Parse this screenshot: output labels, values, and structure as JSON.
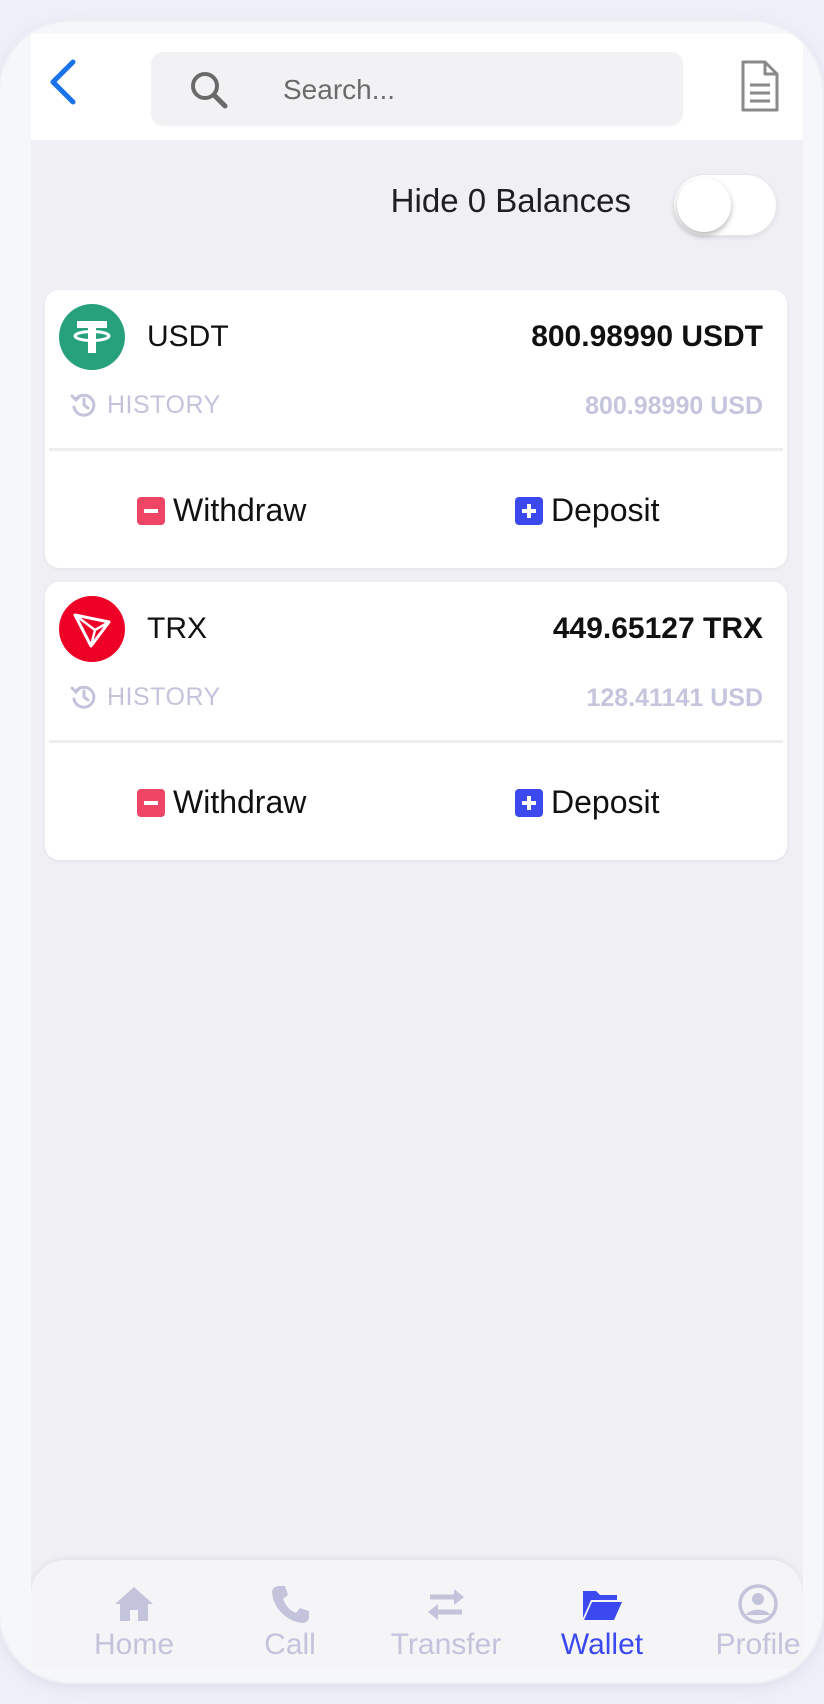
{
  "search": {
    "placeholder": "Search..."
  },
  "settings": {
    "hide_zero_label": "Hide 0 Balances",
    "hide_zero_enabled": false
  },
  "wallets": [
    {
      "symbol": "USDT",
      "balance": "800.98990 USDT",
      "history_label": "HISTORY",
      "usd_value": "800.98990 USD",
      "withdraw_label": "Withdraw",
      "deposit_label": "Deposit",
      "logo_color": "#26a17b"
    },
    {
      "symbol": "TRX",
      "balance": "449.65127 TRX",
      "history_label": "HISTORY",
      "usd_value": "128.41141 USD",
      "withdraw_label": "Withdraw",
      "deposit_label": "Deposit",
      "logo_color": "#ef0027"
    }
  ],
  "nav": {
    "active": "Wallet",
    "items": [
      {
        "label": "Home",
        "icon": "home-icon"
      },
      {
        "label": "Call",
        "icon": "phone-icon"
      },
      {
        "label": "Transfer",
        "icon": "transfer-icon"
      },
      {
        "label": "Wallet",
        "icon": "folder-icon"
      },
      {
        "label": "Profile",
        "icon": "user-circle-icon"
      }
    ]
  },
  "colors": {
    "accent": "#3b49ee",
    "back_arrow": "#1a73e8",
    "withdraw": "#ee4565",
    "deposit": "#3b49ee",
    "muted": "#c3c3dc"
  }
}
